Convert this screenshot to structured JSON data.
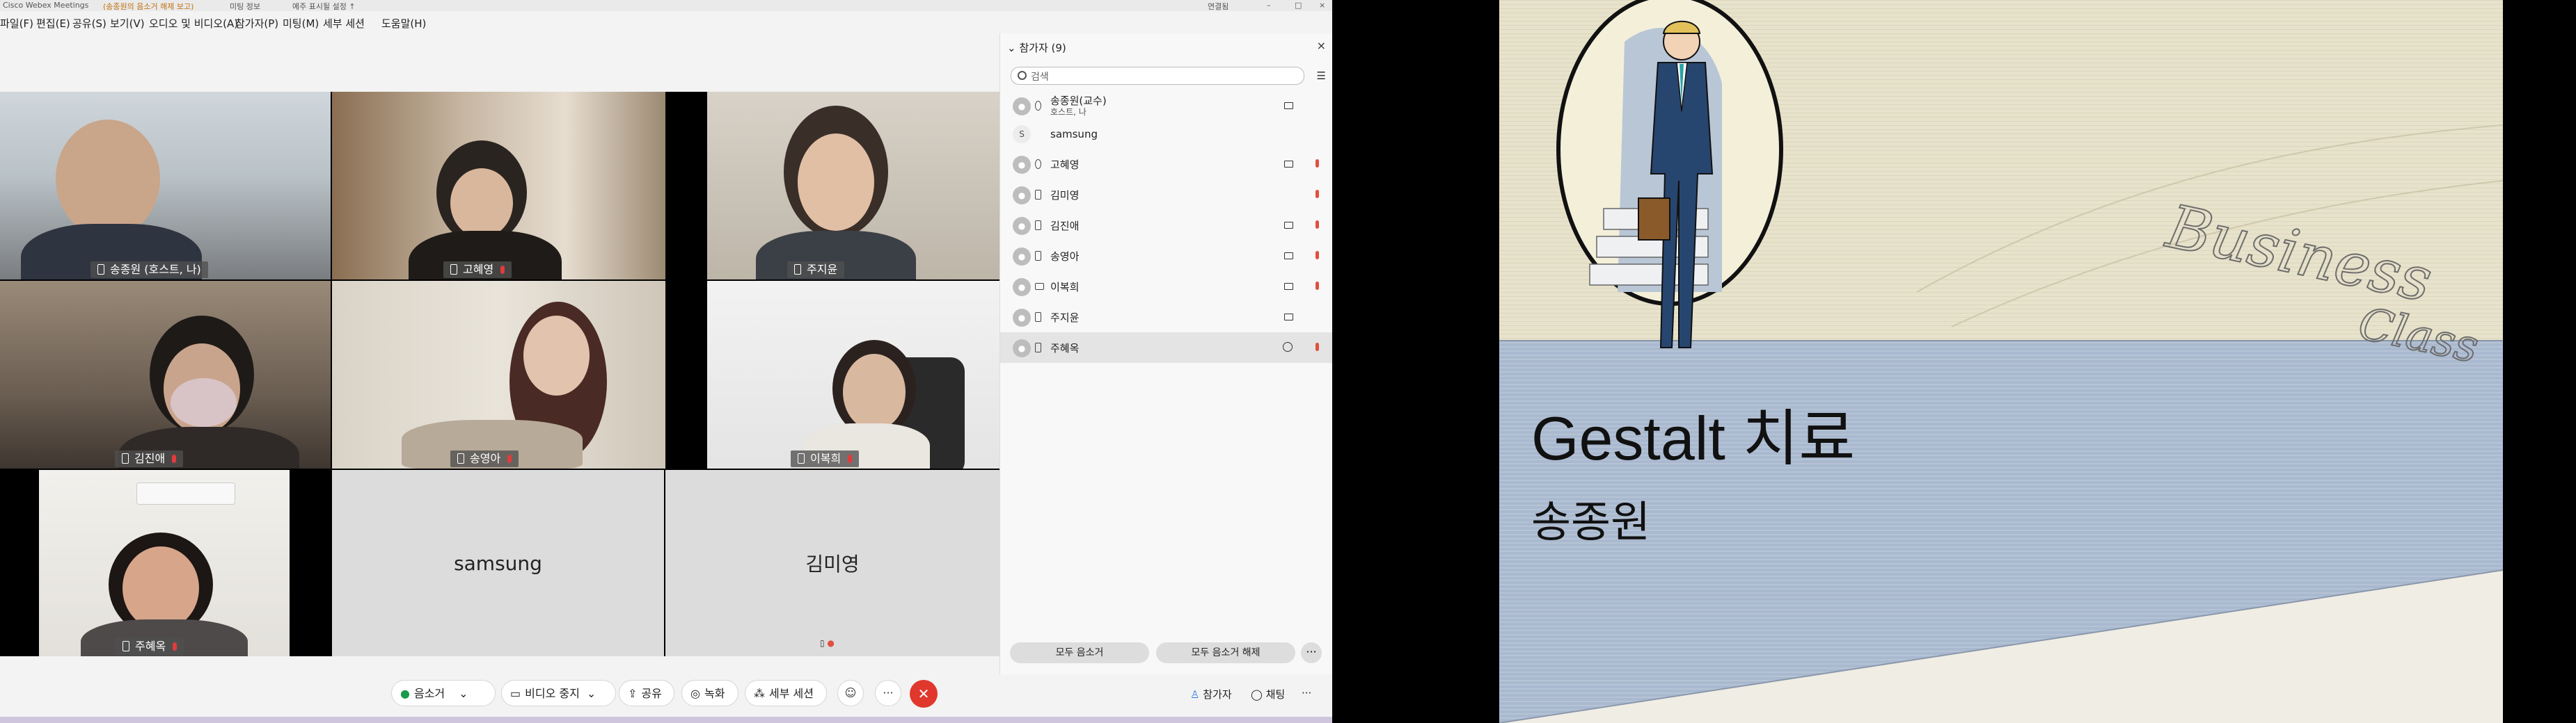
{
  "window": {
    "title": "Cisco Webex Meetings",
    "subtitle": "(송종원의 음소거 해제 보고)",
    "status": "미팅 정보",
    "extra": "예주 표시될 설정 ↑",
    "connected": "연결됨"
  },
  "menu": [
    "파일(F)",
    "편집(E)",
    "공유(S)",
    "보기(V)",
    "오디오 및 비디오(A)",
    "참가자(P)",
    "미팅(M)",
    "세부 세션",
    "도움말(H)"
  ],
  "tiles": [
    {
      "name": "송종원",
      "role": "(호스트, 나)"
    },
    {
      "name": "고혜영"
    },
    {
      "name": "주지윤"
    },
    {
      "name": "김진애"
    },
    {
      "name": "송영아"
    },
    {
      "name": "이복희"
    },
    {
      "name": "주혜옥"
    },
    {
      "name": "samsung"
    },
    {
      "name": "김미영"
    }
  ],
  "panel": {
    "title": "참가자 (9)",
    "search_placeholder": "검색",
    "participants": [
      {
        "name": "송종원(교수)",
        "sub": "호스트, 나"
      },
      {
        "name": "samsung",
        "initial": "S"
      },
      {
        "name": "고혜영"
      },
      {
        "name": "김미영"
      },
      {
        "name": "김진애"
      },
      {
        "name": "송영아"
      },
      {
        "name": "이복희"
      },
      {
        "name": "주지윤"
      },
      {
        "name": "주혜옥"
      }
    ],
    "mute_all": "모두 음소거",
    "unmute_all": "모두 음소거 해제"
  },
  "toolbar": {
    "mute": "음소거",
    "video": "비디오 중지",
    "share": "공유",
    "record": "녹화",
    "breakout": "세부 세션",
    "participants": "참가자",
    "chat": "채팅"
  },
  "slide": {
    "title": "Gestalt 치료",
    "subtitle": "송종원",
    "logo_text": "Business Class"
  },
  "colors": {
    "end_call": "#e0382d",
    "mic_muted": "#e0503f",
    "slide_blue": "#a9b9cf",
    "slide_cream": "#e7e2cb"
  }
}
